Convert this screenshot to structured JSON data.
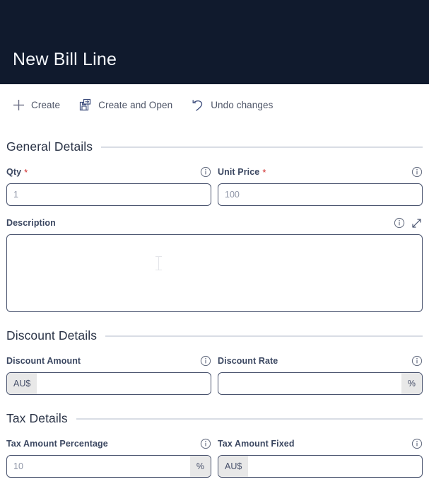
{
  "header": {
    "title": "New Bill Line",
    "background_color": "#101a2d",
    "title_color": "#f4f7fb"
  },
  "toolbar": {
    "actions": [
      {
        "label": "Create",
        "icon": "plus-icon"
      },
      {
        "label": "Create and Open",
        "icon": "save-and-open-icon"
      },
      {
        "label": "Undo changes",
        "icon": "undo-icon"
      }
    ]
  },
  "sections": [
    {
      "title": "General Details",
      "fields": [
        {
          "label": "Qty",
          "required": true,
          "value": "1",
          "placeholder": "1",
          "prefix": "",
          "suffix": "",
          "info_icon": "info-icon"
        },
        {
          "label": "Unit Price",
          "required": true,
          "value": "100",
          "placeholder": "100",
          "prefix": "",
          "suffix": "",
          "info_icon": "info-icon"
        },
        {
          "label": "Description",
          "required": false,
          "value": "",
          "placeholder": "",
          "info_icon": "info-icon",
          "expand_icon": "expand-diagonal-icon"
        }
      ]
    },
    {
      "title": "Discount Details",
      "fields": [
        {
          "label": "Discount Amount",
          "required": false,
          "value": "",
          "placeholder": "",
          "prefix": "AU$",
          "suffix": "",
          "info_icon": "info-icon"
        },
        {
          "label": "Discount Rate",
          "required": false,
          "value": "",
          "placeholder": "",
          "prefix": "",
          "suffix": "%",
          "info_icon": "info-icon"
        }
      ]
    },
    {
      "title": "Tax Details",
      "fields": [
        {
          "label": "Tax Amount Percentage",
          "required": false,
          "value": "10",
          "placeholder": "10",
          "prefix": "",
          "suffix": "%",
          "info_icon": "info-icon"
        },
        {
          "label": "Tax Amount Fixed",
          "required": false,
          "value": "",
          "placeholder": "",
          "prefix": "AU$",
          "suffix": "",
          "info_icon": "info-icon"
        }
      ]
    }
  ],
  "colors": {
    "required_marker": "#cf2a2a",
    "field_border": "#49536e",
    "affix_background": "#e8e8e8",
    "divider": "#d9dde5",
    "label_text": "#3b4761"
  }
}
